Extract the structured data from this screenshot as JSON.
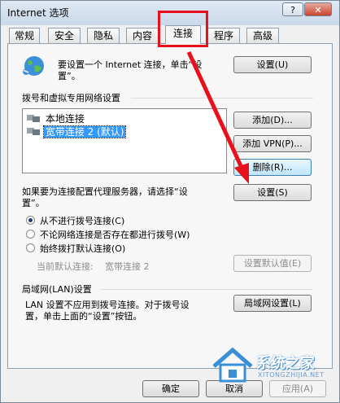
{
  "window": {
    "title": "Internet 选项",
    "help_button": "?",
    "close_button": "✕"
  },
  "tabs": [
    {
      "label": "常规"
    },
    {
      "label": "安全"
    },
    {
      "label": "隐私"
    },
    {
      "label": "内容"
    },
    {
      "label": "连接",
      "active": true
    },
    {
      "label": "程序"
    },
    {
      "label": "高级"
    }
  ],
  "setup": {
    "text_line1": "要设置一个 Internet 连接，单击“设",
    "text_line2": "置”。",
    "button": "设置(U)"
  },
  "dialup": {
    "heading": "拨号和虚拟专用网络设置",
    "items": [
      {
        "label": "本地连接",
        "selected": false
      },
      {
        "label": "宽带连接 2 (默认)",
        "selected": true
      }
    ],
    "add_button": "添加(D)...",
    "add_vpn_button": "添加 VPN(P)...",
    "delete_button": "删除(R)...",
    "proxy_text_line1": "如果要为连接配置代理服务器，请选择“设",
    "proxy_text_line2": "置”。",
    "settings_button": "设置(S)"
  },
  "dial_options": [
    {
      "label": "从不进行拨号连接(C)",
      "checked": true
    },
    {
      "label": "不论网络连接是否存在都进行拨号(W)",
      "checked": false
    },
    {
      "label": "始终拨打默认连接(O)",
      "checked": false
    }
  ],
  "current_default": {
    "label": "当前默认连接:",
    "value": "宽带连接 2",
    "button": "设置默认值(E)"
  },
  "lan": {
    "heading": "局域网(LAN)设置",
    "text_line1": "LAN 设置不应用到拨号连接。对于拨号设",
    "text_line2": "置，单击上面的“设置”按钮。",
    "button": "局域网设置(L)"
  },
  "footer": {
    "ok": "确定",
    "cancel": "取消",
    "apply": "应用(A)"
  },
  "watermark": {
    "title": "系统之家",
    "subtitle": "XITONGZHIJIA.NET"
  },
  "colors": {
    "highlight": "#e8101a",
    "selection": "#3399ff"
  }
}
